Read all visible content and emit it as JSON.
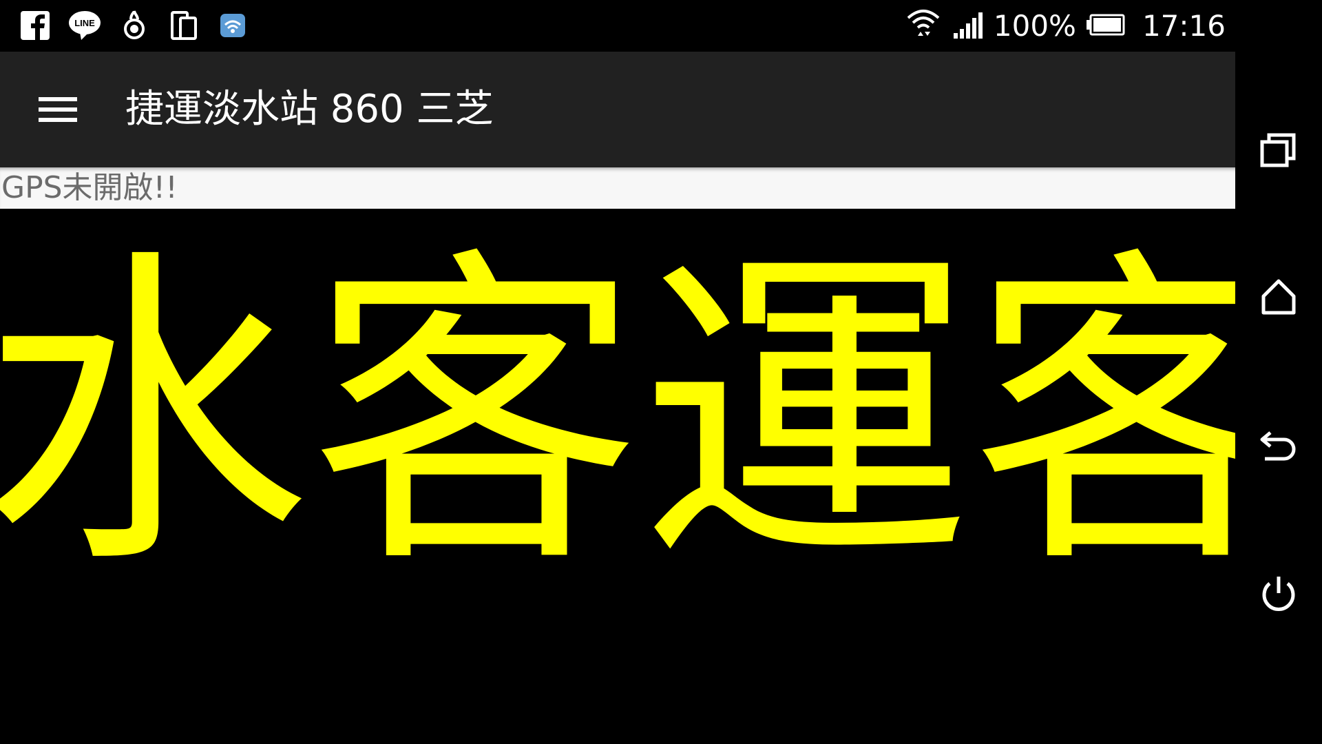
{
  "status_bar": {
    "left_icons": [
      "facebook-icon",
      "line-icon",
      "app-notification-icon",
      "device-icon",
      "wifi-settings-icon"
    ],
    "line_icon_label": "LINE",
    "battery_percent": "100%",
    "time": "17:16"
  },
  "app_bar": {
    "title": "捷運淡水站 860 三芝",
    "menu_icon": "hamburger-menu-icon"
  },
  "gps_status": "GPS未開啟!!",
  "marquee": {
    "text": "水客運客",
    "color": "#ffff00"
  },
  "nav_bar": {
    "buttons": [
      "recent-apps-icon",
      "home-icon",
      "back-icon",
      "power-icon"
    ]
  }
}
